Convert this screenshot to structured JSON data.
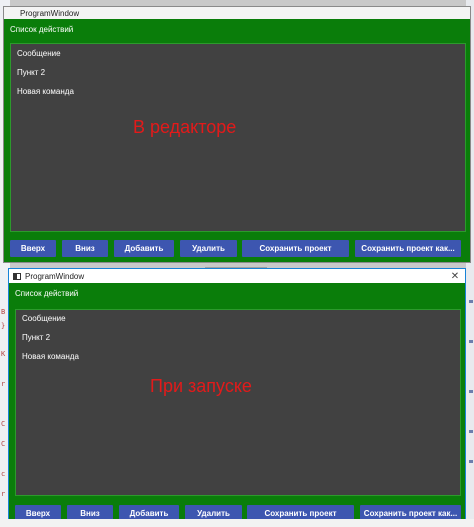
{
  "editor_window": {
    "title": "ProgramWindow",
    "list_header": "Список действий",
    "items": [
      "Сообщение",
      "Пункт 2",
      "Новая команда"
    ],
    "caption": "В редакторе",
    "buttons": {
      "up": "Вверх",
      "down": "Вниз",
      "add": "Добавить",
      "delete": "Удалить",
      "save": "Сохранить проект",
      "save_as": "Сохранить проект как..."
    }
  },
  "runtime_window": {
    "title": "ProgramWindow",
    "close_glyph": "✕",
    "list_header": "Список действий",
    "items": [
      "Сообщение",
      "Пункт 2",
      "Новая команда"
    ],
    "caption": "При запуске",
    "buttons": {
      "up": "Вверх",
      "down": "Вниз",
      "add": "Добавить",
      "delete": "Удалить",
      "save": "Сохранить проект",
      "save_as": "Сохранить проект как..."
    }
  },
  "colors": {
    "window_background": "#0a7d0a",
    "list_background": "#414141",
    "button_background": "#3d56b0",
    "caption_text": "#e21a1a"
  },
  "icons": {
    "window_icon": "window-app-icon",
    "close_icon": "close-icon"
  }
}
